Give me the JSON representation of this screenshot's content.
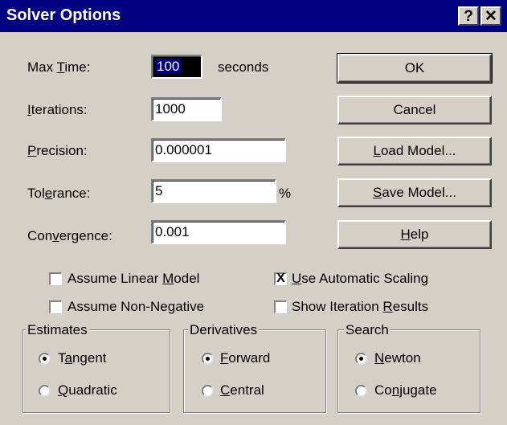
{
  "window": {
    "title": "Solver Options",
    "help_glyph": "?",
    "close_glyph": "✕"
  },
  "fields": {
    "max_time": {
      "label_pre": "Max ",
      "label_key": "T",
      "label_post": "ime:",
      "value": "100",
      "unit": "seconds"
    },
    "iterations": {
      "label_pre": "",
      "label_key": "I",
      "label_post": "terations:",
      "value": "1000"
    },
    "precision": {
      "label_pre": "",
      "label_key": "P",
      "label_post": "recision:",
      "value": "0.000001"
    },
    "tolerance": {
      "label_pre": "Tol",
      "label_key": "e",
      "label_post": "rance:",
      "value": "5",
      "unit": "%"
    },
    "convergence": {
      "label_pre": "Con",
      "label_key": "v",
      "label_post": "ergence:",
      "value": "0.001"
    }
  },
  "buttons": {
    "ok": {
      "pre": "OK",
      "key": "",
      "post": ""
    },
    "cancel": {
      "pre": "Cancel",
      "key": "",
      "post": ""
    },
    "load": {
      "pre": "",
      "key": "L",
      "post": "oad Model..."
    },
    "save": {
      "pre": "",
      "key": "S",
      "post": "ave Model..."
    },
    "help": {
      "pre": "",
      "key": "H",
      "post": "elp"
    }
  },
  "checkboxes": {
    "linear": {
      "pre": "Assume Linear ",
      "key": "M",
      "post": "odel",
      "checked": false
    },
    "nonneg": {
      "pre": "Assume Non-Ne",
      "key": "g",
      "post": "ative",
      "checked": false
    },
    "scaling": {
      "pre": "",
      "key": "U",
      "post": "se Automatic Scaling",
      "checked": true,
      "mark": "X"
    },
    "iteration": {
      "pre": "Show Iteration ",
      "key": "R",
      "post": "esults",
      "checked": false
    }
  },
  "groups": {
    "estimates": {
      "legend": "Estimates",
      "options": [
        {
          "pre": "T",
          "key": "a",
          "post": "ngent",
          "selected": true
        },
        {
          "pre": "",
          "key": "Q",
          "post": "uadratic",
          "selected": false
        }
      ]
    },
    "derivatives": {
      "legend": "Derivatives",
      "options": [
        {
          "pre": "",
          "key": "F",
          "post": "orward",
          "selected": true
        },
        {
          "pre": "",
          "key": "C",
          "post": "entral",
          "selected": false
        }
      ]
    },
    "search": {
      "legend": "Search",
      "options": [
        {
          "pre": "",
          "key": "N",
          "post": "ewton",
          "selected": true
        },
        {
          "pre": "Co",
          "key": "n",
          "post": "jugate",
          "selected": false
        }
      ]
    }
  }
}
